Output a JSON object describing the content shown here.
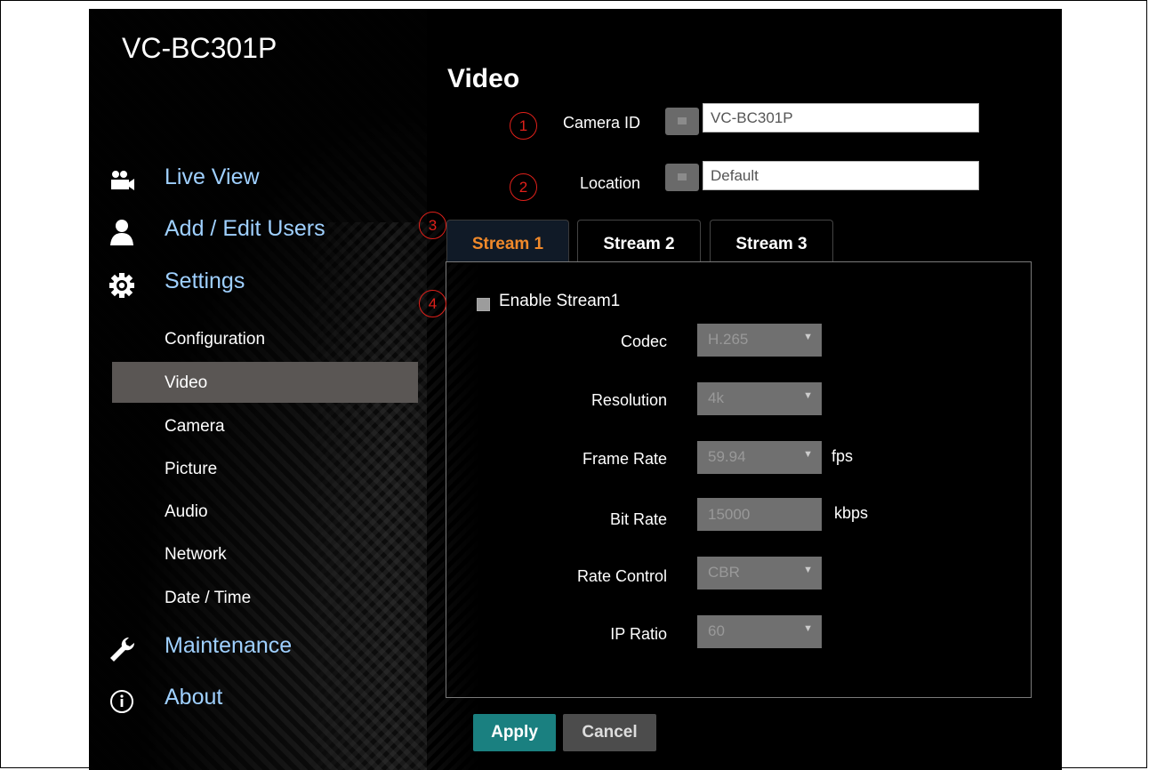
{
  "app": {
    "brand": "VC-BC301P"
  },
  "page": {
    "title": "Video"
  },
  "nav": [
    {
      "label": "Live View",
      "icon": "users-camera-icon"
    },
    {
      "label": "Add / Edit Users",
      "icon": "user-icon"
    },
    {
      "label": "Settings",
      "icon": "gear-icon"
    },
    {
      "label": "Maintenance",
      "icon": "wrench-icon"
    },
    {
      "label": "About",
      "icon": "info-icon"
    }
  ],
  "settings_items": [
    "Configuration",
    "Video",
    "Camera",
    "Picture",
    "Audio",
    "Network",
    "Date / Time"
  ],
  "active_settings_item": "Video",
  "camera_id": {
    "label": "Camera ID",
    "value": "VC-BC301P"
  },
  "location": {
    "label": "Location",
    "value": "Default"
  },
  "markers": [
    "1",
    "2",
    "3",
    "4"
  ],
  "tabs": [
    "Stream 1",
    "Stream 2",
    "Stream 3"
  ],
  "active_tab": "Stream 1",
  "enable_stream": {
    "label": "Enable Stream1",
    "checked": true
  },
  "fields": {
    "codec": {
      "label": "Codec",
      "value": "H.265"
    },
    "resolution": {
      "label": "Resolution",
      "value": "4k"
    },
    "frame_rate": {
      "label": "Frame Rate",
      "value": "59.94",
      "unit": "fps"
    },
    "bit_rate": {
      "label": "Bit Rate",
      "value": "15000",
      "unit": "kbps"
    },
    "rate_control": {
      "label": "Rate Control",
      "value": "CBR"
    },
    "ip_ratio": {
      "label": "IP Ratio",
      "value": "60"
    }
  },
  "buttons": {
    "apply": "Apply",
    "cancel": "Cancel"
  },
  "colors": {
    "accent_tab": "#f0892a",
    "nav_link": "#9fd0ff",
    "apply": "#1a8080",
    "cancel": "#4c4c4c",
    "marker": "#e0201a"
  }
}
